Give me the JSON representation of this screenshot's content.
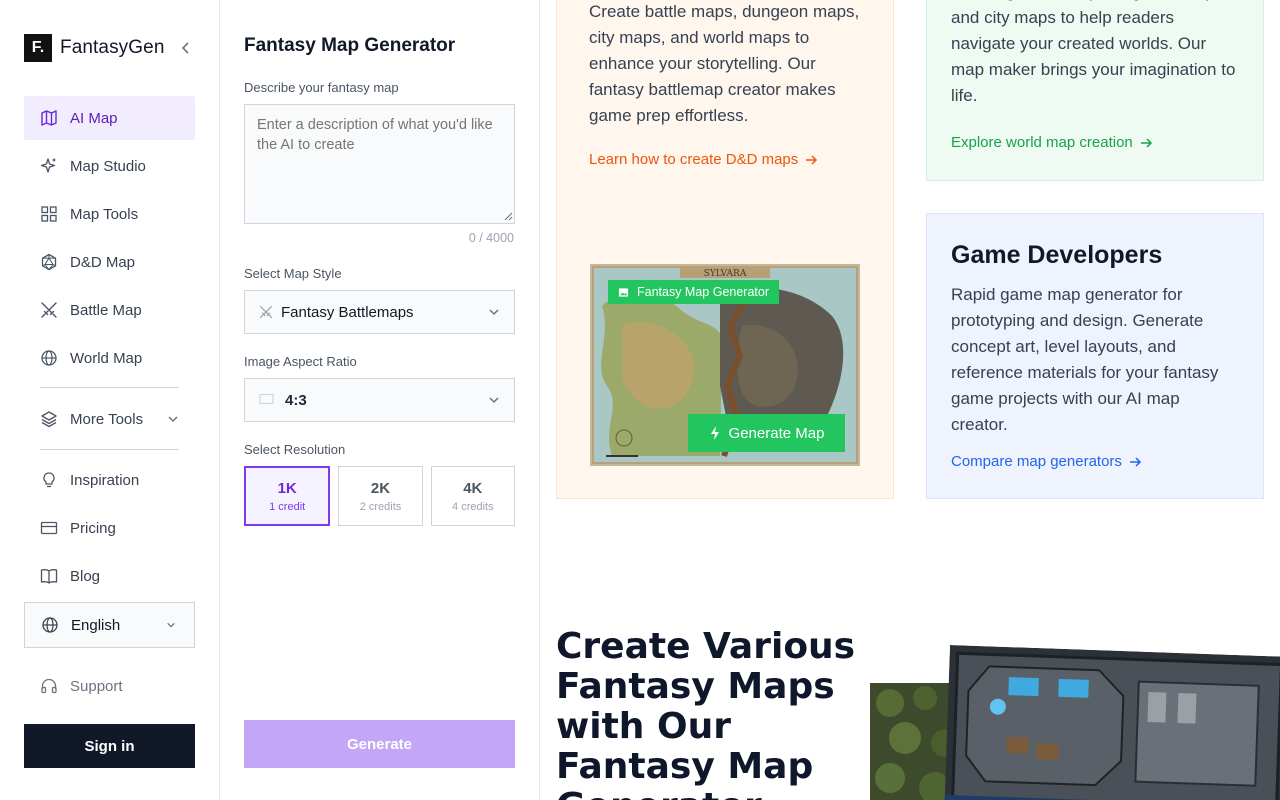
{
  "brand": {
    "logo_letter": "F.",
    "name": "FantasyGen"
  },
  "sidebar": {
    "items": [
      {
        "label": "AI Map",
        "icon": "map-icon",
        "active": true
      },
      {
        "label": "Map Studio",
        "icon": "sparkles-icon"
      },
      {
        "label": "Map Tools",
        "icon": "grid-icon"
      },
      {
        "label": "D&D Map",
        "icon": "d20-icon"
      },
      {
        "label": "Battle Map",
        "icon": "crossed-swords-icon"
      },
      {
        "label": "World Map",
        "icon": "globe-icon"
      },
      {
        "label": "More Tools",
        "icon": "layers-icon",
        "expandable": true
      },
      {
        "label": "Inspiration",
        "icon": "lightbulb-icon"
      },
      {
        "label": "Pricing",
        "icon": "credit-card-icon"
      },
      {
        "label": "Blog",
        "icon": "book-icon"
      }
    ],
    "language": "English",
    "support": "Support",
    "sign_in": "Sign in"
  },
  "generator": {
    "title": "Fantasy Map Generator",
    "description_label": "Describe your fantasy map",
    "description_placeholder": "Enter a description of what you'd like the AI to create",
    "char_counter": "0 / 4000",
    "style_label": "Select Map Style",
    "style_value": "Fantasy Battlemaps",
    "aspect_label": "Image Aspect Ratio",
    "aspect_value": "4:3",
    "resolution_label": "Select Resolution",
    "resolutions": [
      {
        "label": "1K",
        "credits": "1 credit",
        "selected": true
      },
      {
        "label": "2K",
        "credits": "2 credits"
      },
      {
        "label": "4K",
        "credits": "4 credits"
      }
    ],
    "generate_label": "Generate"
  },
  "main": {
    "dnd_card": {
      "text": "Create battle maps, dungeon maps, city maps, and world maps to enhance your storytelling. Our fantasy battlemap creator makes game prep effortless.",
      "link": "Learn how to create D&D maps",
      "badge": "Fantasy Map Generator",
      "cta": "Generate Map",
      "map_banner": "SYLVARA"
    },
    "world_card": {
      "text": "stunning world maps, regional maps, and city maps to help readers navigate your created worlds. Our map maker brings your imagination to life.",
      "link": "Explore world map creation"
    },
    "game_card": {
      "heading": "Game Developers",
      "text": "Rapid game map generator for prototyping and design. Generate concept art, level layouts, and reference materials for your fantasy game projects with our AI map creator.",
      "link": "Compare map generators"
    },
    "section_title": "Create Various Fantasy Maps with Our Fantasy Map Generator"
  },
  "colors": {
    "accent": "#7c3aed",
    "accent_soft": "#f1edfe",
    "green": "#22c55e",
    "orange_link": "#ea580c",
    "green_link": "#16a34a",
    "blue_link": "#2563eb",
    "dark": "#111827"
  }
}
